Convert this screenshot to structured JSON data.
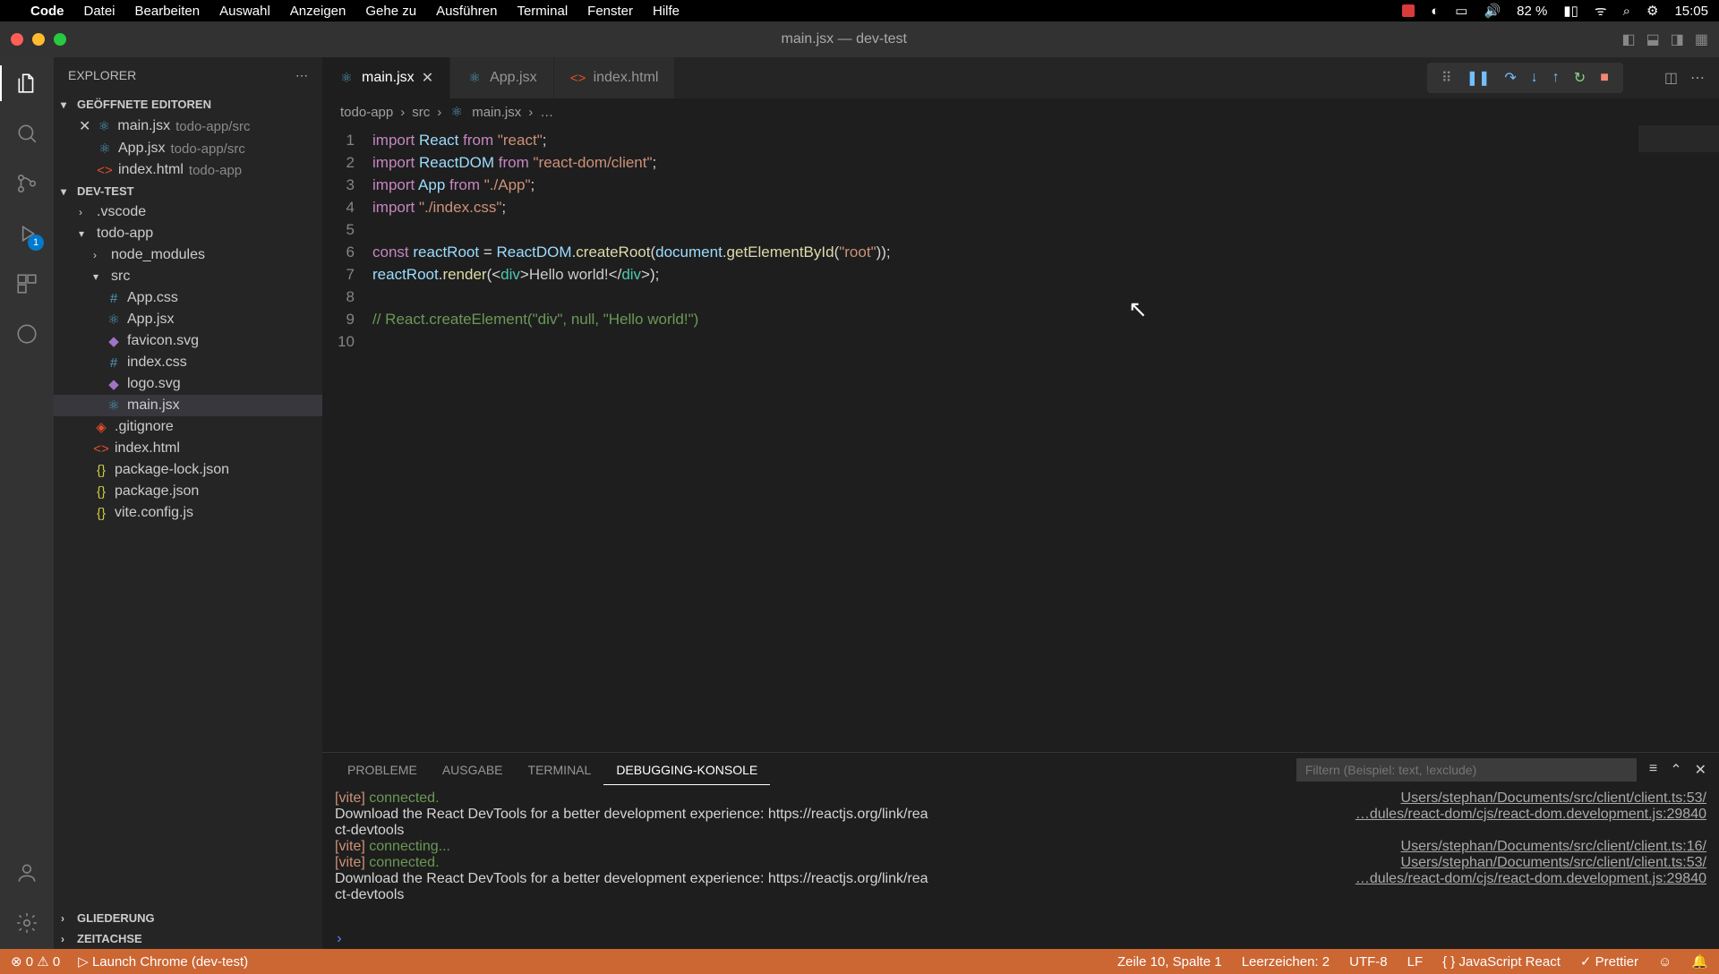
{
  "menubar": {
    "app": "Code",
    "items": [
      "Datei",
      "Bearbeiten",
      "Auswahl",
      "Anzeigen",
      "Gehe zu",
      "Ausführen",
      "Terminal",
      "Fenster",
      "Hilfe"
    ],
    "battery": "82 %",
    "time": "15:05"
  },
  "titlebar": {
    "title": "main.jsx — dev-test"
  },
  "sidebar": {
    "header": "EXPLORER",
    "open_editors_label": "GEÖFFNETE EDITOREN",
    "open_editors": [
      {
        "name": "main.jsx",
        "path": "todo-app/src",
        "close": true
      },
      {
        "name": "App.jsx",
        "path": "todo-app/src"
      },
      {
        "name": "index.html",
        "path": "todo-app"
      }
    ],
    "project_label": "DEV-TEST",
    "tree": {
      "vscode": ".vscode",
      "todo_app": "todo-app",
      "node_modules": "node_modules",
      "src": "src",
      "files_src": [
        "App.css",
        "App.jsx",
        "favicon.svg",
        "index.css",
        "logo.svg",
        "main.jsx"
      ],
      "gitignore": ".gitignore",
      "index_html": "index.html",
      "pkg_lock": "package-lock.json",
      "pkg": "package.json",
      "vite": "vite.config.js"
    },
    "outline": "GLIEDERUNG",
    "timeline": "ZEITACHSE"
  },
  "tabs": [
    {
      "name": "main.jsx",
      "icon": "jsx",
      "active": true
    },
    {
      "name": "App.jsx",
      "icon": "jsx"
    },
    {
      "name": "index.html",
      "icon": "html"
    }
  ],
  "breadcrumbs": [
    "todo-app",
    "src",
    "main.jsx",
    "…"
  ],
  "code_lines": 10,
  "panel": {
    "tabs": [
      "PROBLEME",
      "AUSGABE",
      "TERMINAL",
      "DEBUGGING-KONSOLE"
    ],
    "active": 3,
    "filter_placeholder": "Filtern (Beispiel: text, !exclude)",
    "lines": [
      {
        "left_blue": "[vite]",
        "left": " connected.",
        "right": "Users/stephan/Documents/src/client/client.ts:53/"
      },
      {
        "left": "Download the React DevTools for a better development experience: https://reactjs.org/link/rea",
        "right": "…dules/react-dom/cjs/react-dom.development.js:29840",
        "cont": "ct-devtools"
      },
      {
        "left_blue": "[vite]",
        "left": " connecting...",
        "right": "Users/stephan/Documents/src/client/client.ts:16/"
      },
      {
        "left_blue": "[vite]",
        "left": " connected.",
        "right": "Users/stephan/Documents/src/client/client.ts:53/"
      },
      {
        "left": "Download the React DevTools for a better development experience: https://reactjs.org/link/rea",
        "right": "…dules/react-dom/cjs/react-dom.development.js:29840",
        "cont": "ct-devtools"
      }
    ]
  },
  "statusbar": {
    "errors": "0",
    "warnings": "0",
    "launch": "Launch Chrome (dev-test)",
    "line_col": "Zeile 10, Spalte 1",
    "spaces": "Leerzeichen: 2",
    "encoding": "UTF-8",
    "eol": "LF",
    "lang": "JavaScript React",
    "prettier": "Prettier"
  },
  "badges": {
    "run_debug": "1"
  }
}
